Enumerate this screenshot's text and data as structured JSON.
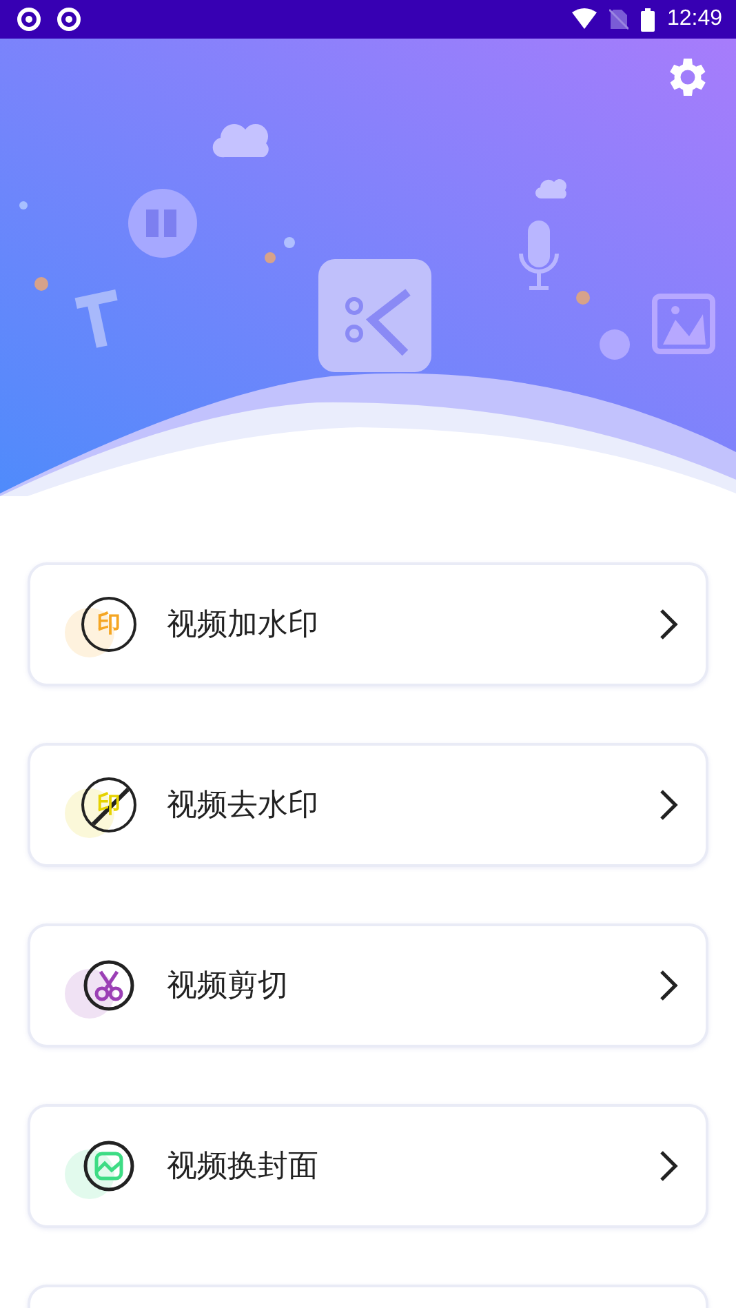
{
  "status_bar": {
    "time": "12:49"
  },
  "features": [
    {
      "kind": "watermark-add",
      "label": "视频加水印",
      "glyph": "印",
      "color": "#f5a623"
    },
    {
      "kind": "watermark-remove",
      "label": "视频去水印",
      "glyph": "印",
      "color": "#e6d200"
    },
    {
      "kind": "cut",
      "label": "视频剪切",
      "color": "#9b3fb5"
    },
    {
      "kind": "cover",
      "label": "视频换封面",
      "color": "#3ddc84"
    },
    {
      "kind": "blank"
    }
  ]
}
